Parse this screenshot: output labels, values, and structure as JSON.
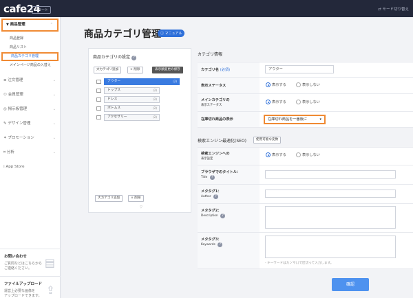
{
  "topbar": {
    "logo": "cafe24",
    "badge": "スタート",
    "mode_switch": "⇄ モード切り替え"
  },
  "sidebar": {
    "items": [
      {
        "label": "商品管理",
        "icon": "tag-icon"
      },
      {
        "label": "注文管理",
        "icon": "cart-icon"
      },
      {
        "label": "会員管理",
        "icon": "user-icon"
      },
      {
        "label": "掲示板管理",
        "icon": "board-icon"
      },
      {
        "label": "デザイン管理",
        "icon": "brush-icon"
      },
      {
        "label": "プロモーション",
        "icon": "gift-icon"
      },
      {
        "label": "分析",
        "icon": "chart-icon"
      },
      {
        "label": "App Store",
        "icon": "grid-icon"
      }
    ],
    "sub_items": [
      "商品登録",
      "商品リスト",
      "商品カテゴリ管理",
      "メインページ商品の入替え"
    ],
    "inquiry": {
      "title": "お問い合わせ",
      "text1": "ご質問などはこちらから",
      "text2": "ご連絡ください。"
    },
    "upload": {
      "title": "ファイルアップロード",
      "text1": "運営上必要な画像を",
      "text2": "アップロードできます。"
    }
  },
  "main": {
    "title": "商品カテゴリ管理",
    "manual": "マニュアル"
  },
  "left_panel": {
    "title": "商品カテゴリの設定",
    "add_major": "大カテゴリ追加",
    "delete": "× 削除",
    "display_settings": "表示順変更の保存",
    "categories": [
      {
        "label": "アウター",
        "count": "(2)"
      },
      {
        "label": "トップス",
        "count": "(2)"
      },
      {
        "label": "ドレス",
        "count": "(2)"
      },
      {
        "label": "ボトムス",
        "count": "(2)"
      },
      {
        "label": "アクセサリー",
        "count": "(2)"
      }
    ],
    "add_major_bottom": "大カテゴリ追加",
    "delete_bottom": "× 削除"
  },
  "right_panel": {
    "title": "カテゴリ情報",
    "name_label": "カテゴリ名",
    "name_required": "(必須)",
    "name_value": "アウター",
    "status_label": "表示ステータス",
    "main_status_label1": "メインカテゴリの",
    "main_status_label2": "表示ステータス",
    "soldout_label": "在庫切れ商品の表示",
    "soldout_value": "在庫切れ商品を一番後に",
    "show": "表示する",
    "hide": "表示しない",
    "seo_title": "検索エンジン最適化(SEO)",
    "seo_btn": "使用可能な変数",
    "seo_show_label1": "検索エンジンへの",
    "seo_show_label2": "表示設定",
    "browser_title_label": "ブラウザでのタイトル：",
    "browser_title_sub": "Title",
    "meta1_label": "メタタグ1：",
    "meta1_sub": "Author",
    "meta2_label": "メタタグ2：",
    "meta2_sub": "Description",
    "meta3_label": "メタタグ3：",
    "meta3_sub": "Keywords",
    "keywords_hint": "- キーワードはカンマ(,)で区切って入力します。",
    "confirm": "確認"
  },
  "colors": {
    "accent": "#2e6fd9",
    "highlight": "#f08a33",
    "topbar": "#23283a",
    "confirm": "#4e92ef"
  }
}
